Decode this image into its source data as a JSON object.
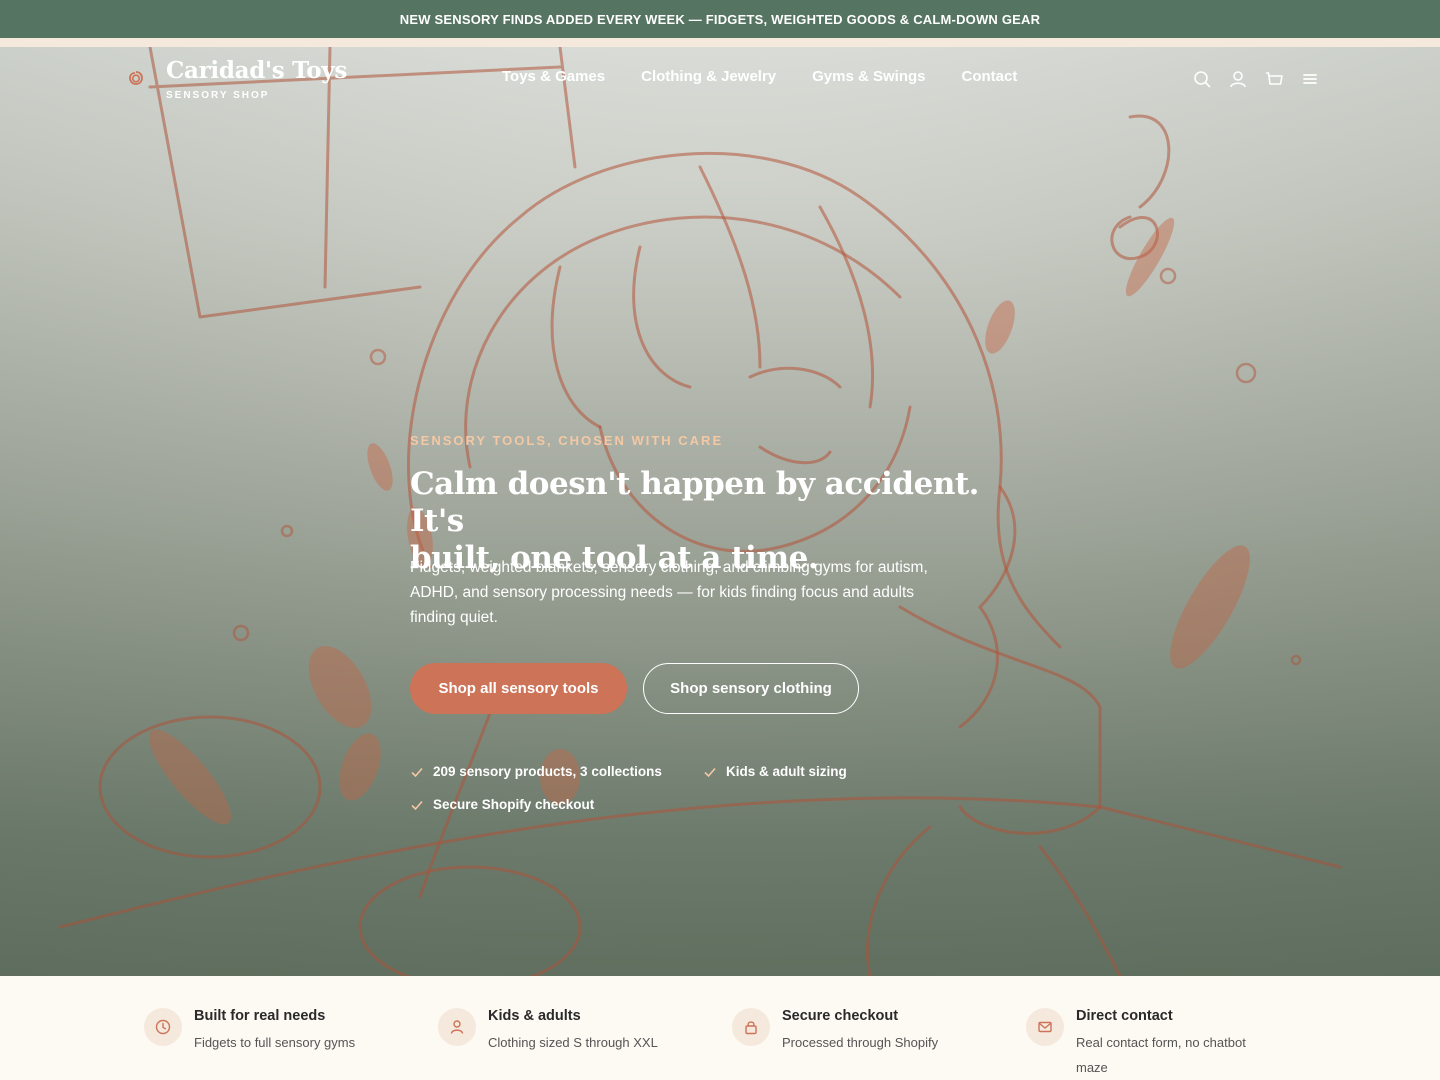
{
  "announcement": "NEW SENSORY FINDS ADDED EVERY WEEK — FIDGETS, WEIGHTED GOODS & CALM-DOWN GEAR",
  "brand": {
    "name": "Caridad's Toys",
    "tagline": "SENSORY SHOP"
  },
  "nav": {
    "links": [
      {
        "label": "Toys & Games"
      },
      {
        "label": "Clothing & Jewelry"
      },
      {
        "label": "Gyms & Swings"
      },
      {
        "label": "Contact"
      }
    ],
    "icons": [
      "search-icon",
      "account-icon",
      "cart-icon",
      "menu-icon"
    ]
  },
  "hero": {
    "eyebrow": "SENSORY TOOLS, CHOSEN WITH CARE",
    "headline_line1": "Calm doesn't happen by accident. It's",
    "headline_line2": "built, one tool at a time.",
    "subtext": "Fidgets, weighted blankets, sensory clothing, and climbing gyms for autism, ADHD, and sensory processing needs — for kids finding focus and adults finding quiet.",
    "primary_cta": "Shop all sensory tools",
    "secondary_cta": "Shop sensory clothing",
    "perks": [
      "209 sensory products, 3 collections",
      "Kids & adult sizing",
      "Secure Shopify checkout"
    ]
  },
  "features": [
    {
      "icon": "clock-icon",
      "title": "Built for real needs",
      "desc": "Fidgets to full sensory gyms"
    },
    {
      "icon": "person-icon",
      "title": "Kids & adults",
      "desc": "Clothing sized S through XXL"
    },
    {
      "icon": "lock-icon",
      "title": "Secure checkout",
      "desc": "Processed through Shopify"
    },
    {
      "icon": "mail-icon",
      "title": "Direct contact",
      "desc_line1": "Real contact form, no chatbot",
      "desc_line2": "maze"
    }
  ],
  "colors": {
    "announce_bg": "#557461",
    "accent": "#cc7358",
    "eyebrow": "#f3c8a4",
    "sketch": "#b5533a"
  }
}
